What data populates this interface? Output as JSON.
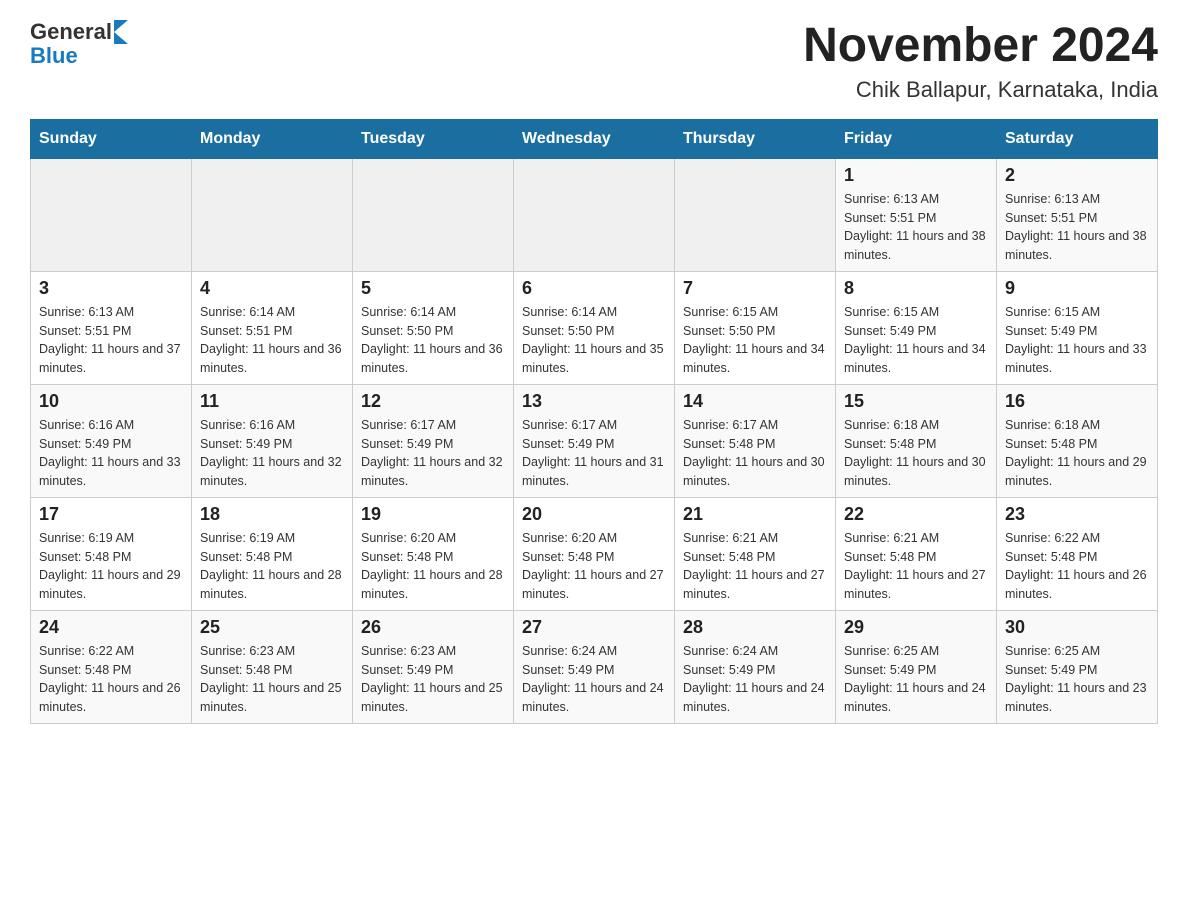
{
  "header": {
    "logo_general": "General",
    "logo_blue": "Blue",
    "title": "November 2024",
    "subtitle": "Chik Ballapur, Karnataka, India"
  },
  "days_of_week": [
    "Sunday",
    "Monday",
    "Tuesday",
    "Wednesday",
    "Thursday",
    "Friday",
    "Saturday"
  ],
  "weeks": [
    [
      {
        "day": "",
        "sunrise": "",
        "sunset": "",
        "daylight": ""
      },
      {
        "day": "",
        "sunrise": "",
        "sunset": "",
        "daylight": ""
      },
      {
        "day": "",
        "sunrise": "",
        "sunset": "",
        "daylight": ""
      },
      {
        "day": "",
        "sunrise": "",
        "sunset": "",
        "daylight": ""
      },
      {
        "day": "",
        "sunrise": "",
        "sunset": "",
        "daylight": ""
      },
      {
        "day": "1",
        "sunrise": "Sunrise: 6:13 AM",
        "sunset": "Sunset: 5:51 PM",
        "daylight": "Daylight: 11 hours and 38 minutes."
      },
      {
        "day": "2",
        "sunrise": "Sunrise: 6:13 AM",
        "sunset": "Sunset: 5:51 PM",
        "daylight": "Daylight: 11 hours and 38 minutes."
      }
    ],
    [
      {
        "day": "3",
        "sunrise": "Sunrise: 6:13 AM",
        "sunset": "Sunset: 5:51 PM",
        "daylight": "Daylight: 11 hours and 37 minutes."
      },
      {
        "day": "4",
        "sunrise": "Sunrise: 6:14 AM",
        "sunset": "Sunset: 5:51 PM",
        "daylight": "Daylight: 11 hours and 36 minutes."
      },
      {
        "day": "5",
        "sunrise": "Sunrise: 6:14 AM",
        "sunset": "Sunset: 5:50 PM",
        "daylight": "Daylight: 11 hours and 36 minutes."
      },
      {
        "day": "6",
        "sunrise": "Sunrise: 6:14 AM",
        "sunset": "Sunset: 5:50 PM",
        "daylight": "Daylight: 11 hours and 35 minutes."
      },
      {
        "day": "7",
        "sunrise": "Sunrise: 6:15 AM",
        "sunset": "Sunset: 5:50 PM",
        "daylight": "Daylight: 11 hours and 34 minutes."
      },
      {
        "day": "8",
        "sunrise": "Sunrise: 6:15 AM",
        "sunset": "Sunset: 5:49 PM",
        "daylight": "Daylight: 11 hours and 34 minutes."
      },
      {
        "day": "9",
        "sunrise": "Sunrise: 6:15 AM",
        "sunset": "Sunset: 5:49 PM",
        "daylight": "Daylight: 11 hours and 33 minutes."
      }
    ],
    [
      {
        "day": "10",
        "sunrise": "Sunrise: 6:16 AM",
        "sunset": "Sunset: 5:49 PM",
        "daylight": "Daylight: 11 hours and 33 minutes."
      },
      {
        "day": "11",
        "sunrise": "Sunrise: 6:16 AM",
        "sunset": "Sunset: 5:49 PM",
        "daylight": "Daylight: 11 hours and 32 minutes."
      },
      {
        "day": "12",
        "sunrise": "Sunrise: 6:17 AM",
        "sunset": "Sunset: 5:49 PM",
        "daylight": "Daylight: 11 hours and 32 minutes."
      },
      {
        "day": "13",
        "sunrise": "Sunrise: 6:17 AM",
        "sunset": "Sunset: 5:49 PM",
        "daylight": "Daylight: 11 hours and 31 minutes."
      },
      {
        "day": "14",
        "sunrise": "Sunrise: 6:17 AM",
        "sunset": "Sunset: 5:48 PM",
        "daylight": "Daylight: 11 hours and 30 minutes."
      },
      {
        "day": "15",
        "sunrise": "Sunrise: 6:18 AM",
        "sunset": "Sunset: 5:48 PM",
        "daylight": "Daylight: 11 hours and 30 minutes."
      },
      {
        "day": "16",
        "sunrise": "Sunrise: 6:18 AM",
        "sunset": "Sunset: 5:48 PM",
        "daylight": "Daylight: 11 hours and 29 minutes."
      }
    ],
    [
      {
        "day": "17",
        "sunrise": "Sunrise: 6:19 AM",
        "sunset": "Sunset: 5:48 PM",
        "daylight": "Daylight: 11 hours and 29 minutes."
      },
      {
        "day": "18",
        "sunrise": "Sunrise: 6:19 AM",
        "sunset": "Sunset: 5:48 PM",
        "daylight": "Daylight: 11 hours and 28 minutes."
      },
      {
        "day": "19",
        "sunrise": "Sunrise: 6:20 AM",
        "sunset": "Sunset: 5:48 PM",
        "daylight": "Daylight: 11 hours and 28 minutes."
      },
      {
        "day": "20",
        "sunrise": "Sunrise: 6:20 AM",
        "sunset": "Sunset: 5:48 PM",
        "daylight": "Daylight: 11 hours and 27 minutes."
      },
      {
        "day": "21",
        "sunrise": "Sunrise: 6:21 AM",
        "sunset": "Sunset: 5:48 PM",
        "daylight": "Daylight: 11 hours and 27 minutes."
      },
      {
        "day": "22",
        "sunrise": "Sunrise: 6:21 AM",
        "sunset": "Sunset: 5:48 PM",
        "daylight": "Daylight: 11 hours and 27 minutes."
      },
      {
        "day": "23",
        "sunrise": "Sunrise: 6:22 AM",
        "sunset": "Sunset: 5:48 PM",
        "daylight": "Daylight: 11 hours and 26 minutes."
      }
    ],
    [
      {
        "day": "24",
        "sunrise": "Sunrise: 6:22 AM",
        "sunset": "Sunset: 5:48 PM",
        "daylight": "Daylight: 11 hours and 26 minutes."
      },
      {
        "day": "25",
        "sunrise": "Sunrise: 6:23 AM",
        "sunset": "Sunset: 5:48 PM",
        "daylight": "Daylight: 11 hours and 25 minutes."
      },
      {
        "day": "26",
        "sunrise": "Sunrise: 6:23 AM",
        "sunset": "Sunset: 5:49 PM",
        "daylight": "Daylight: 11 hours and 25 minutes."
      },
      {
        "day": "27",
        "sunrise": "Sunrise: 6:24 AM",
        "sunset": "Sunset: 5:49 PM",
        "daylight": "Daylight: 11 hours and 24 minutes."
      },
      {
        "day": "28",
        "sunrise": "Sunrise: 6:24 AM",
        "sunset": "Sunset: 5:49 PM",
        "daylight": "Daylight: 11 hours and 24 minutes."
      },
      {
        "day": "29",
        "sunrise": "Sunrise: 6:25 AM",
        "sunset": "Sunset: 5:49 PM",
        "daylight": "Daylight: 11 hours and 24 minutes."
      },
      {
        "day": "30",
        "sunrise": "Sunrise: 6:25 AM",
        "sunset": "Sunset: 5:49 PM",
        "daylight": "Daylight: 11 hours and 23 minutes."
      }
    ]
  ]
}
